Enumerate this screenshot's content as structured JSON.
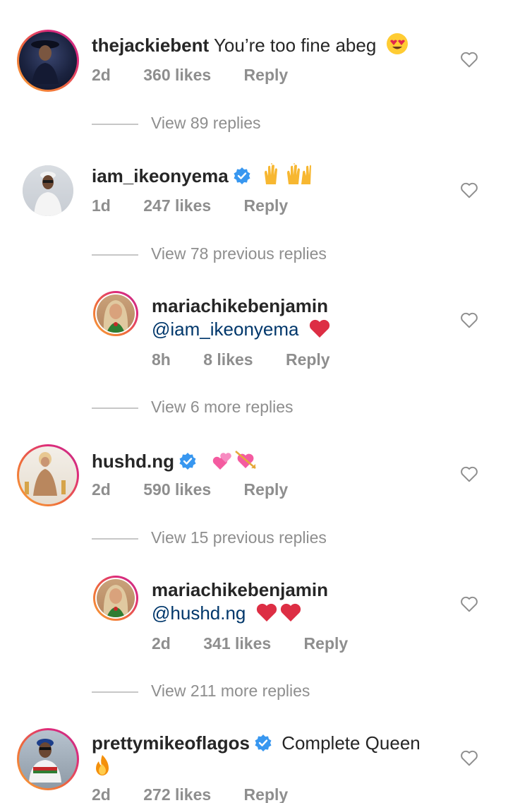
{
  "comments": [
    {
      "username": "thejackiebent",
      "text": "You’re too fine abeg",
      "emoji": "heart-eyes",
      "time": "2d",
      "likes": "360 likes",
      "reply": "Reply"
    },
    {
      "username": "iam_ikeonyema",
      "emoji": "raised-hands",
      "time": "1d",
      "likes": "247 likes",
      "reply": "Reply"
    },
    {
      "username": "mariachikebenjamin",
      "mention": "@iam_ikeonyema",
      "emoji": "red-heart",
      "time": "8h",
      "likes": "8 likes",
      "reply": "Reply"
    },
    {
      "username": "hushd.ng",
      "emoji": "hearts-cupid",
      "time": "2d",
      "likes": "590 likes",
      "reply": "Reply"
    },
    {
      "username": "mariachikebenjamin",
      "mention": "@hushd.ng",
      "emoji": "two-red-hearts",
      "time": "2d",
      "likes": "341 likes",
      "reply": "Reply"
    },
    {
      "username": "prettymikeoflagos",
      "text": "Complete Queen",
      "emoji": "fire",
      "time": "2d",
      "likes": "272 likes",
      "reply": "Reply"
    }
  ],
  "view_replies": [
    "View 89 replies",
    "View 78 previous replies",
    "View 6 more replies",
    "View 15 previous replies",
    "View 211 more replies"
  ],
  "colors": {
    "username": "#262626",
    "meta": "#8e8e8e",
    "mention": "#00376b",
    "verified": "#3897f0",
    "story_ring_start": "#f9a23a",
    "story_ring_end": "#c13584"
  }
}
